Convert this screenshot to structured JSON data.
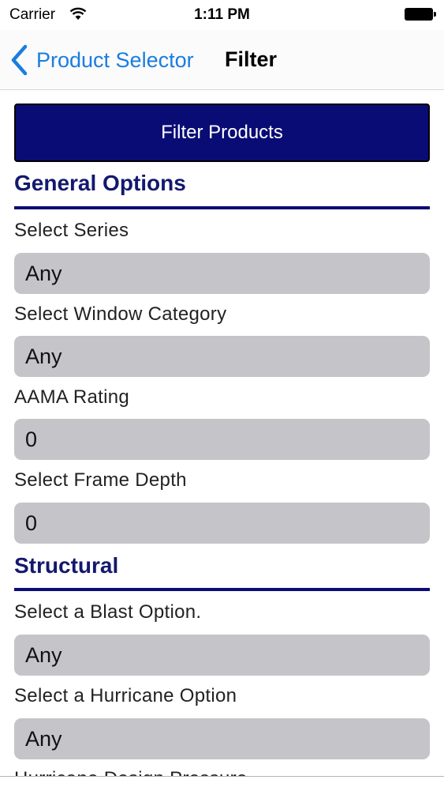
{
  "status": {
    "carrier": "Carrier",
    "time": "1:11 PM"
  },
  "nav": {
    "back_label": "Product Selector",
    "title": "Filter"
  },
  "filter_button_label": "Filter Products",
  "sections": {
    "general": {
      "title": "General Options",
      "fields": [
        {
          "label": "Select Series",
          "value": "Any"
        },
        {
          "label": "Select Window Category",
          "value": "Any"
        },
        {
          "label": "AAMA Rating",
          "value": "0"
        },
        {
          "label": "Select Frame Depth",
          "value": "0"
        }
      ]
    },
    "structural": {
      "title": "Structural",
      "fields": [
        {
          "label": "Select a Blast Option.",
          "value": "Any"
        },
        {
          "label": "Select a Hurricane Option",
          "value": "Any"
        }
      ]
    }
  },
  "partial_label": "Hurricane Design Pressure",
  "colors": {
    "accent_navy": "#0a0c75",
    "ios_blue": "#1a7de0",
    "field_gray": "#c5c4c9"
  }
}
